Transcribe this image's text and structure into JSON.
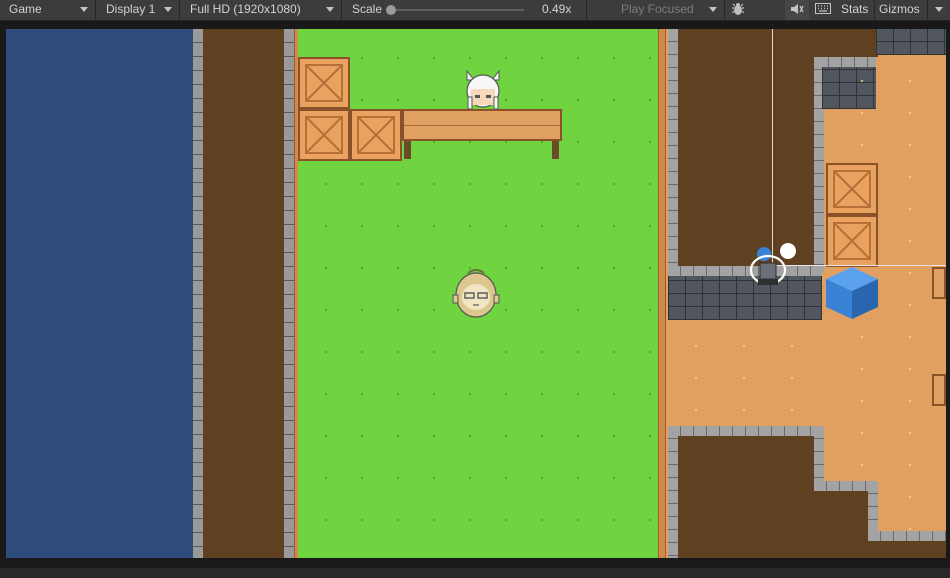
{
  "toolbar": {
    "view_mode": "Game",
    "display": "Display 1",
    "resolution": "Full HD (1920x1080)",
    "scale_label": "Scale",
    "scale_value": "0.49x",
    "play_mode": "Play Focused",
    "stats_label": "Stats",
    "gizmos_label": "Gizmos"
  },
  "colors": {
    "water": "#2f4d7c",
    "grass": "#6fd43f",
    "dirt": "#5f4020",
    "floor": "#e1a05f",
    "crate": "#e9a25f",
    "blue_cube": "#3a82d6"
  },
  "icons": {
    "debug": "bug-icon",
    "mute": "mute-audio-icon",
    "shortcuts": "keyboard-icon",
    "gizmos_menu": "chevron-down-icon"
  },
  "scene": {
    "characters": [
      "white-haired-cat-girl-sprite",
      "green-haired-girl-sprite",
      "player-sprite"
    ],
    "crate_count": 5,
    "objects": [
      "bench",
      "blue-cube"
    ]
  }
}
